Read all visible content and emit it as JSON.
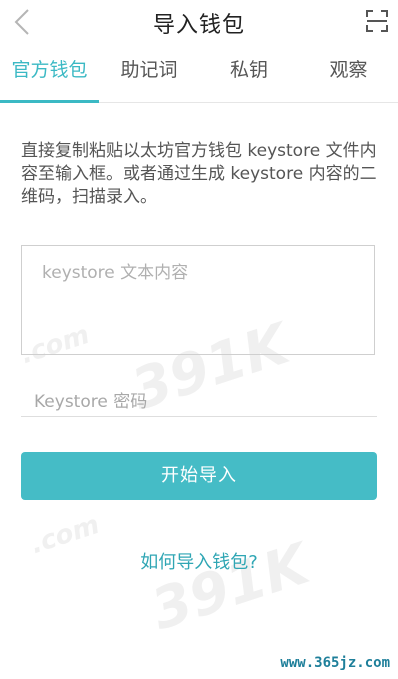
{
  "header": {
    "title": "导入钱包"
  },
  "tabs": [
    {
      "label": "官方钱包",
      "active": true
    },
    {
      "label": "助记词",
      "active": false
    },
    {
      "label": "私钥",
      "active": false
    },
    {
      "label": "观察",
      "active": false
    }
  ],
  "description": "直接复制粘贴以太坊官方钱包 keystore 文件内容至输入框。或者通过生成 keystore 内容的二维码，扫描录入。",
  "keystore_input": {
    "placeholder": "keystore 文本内容",
    "value": ""
  },
  "password_input": {
    "placeholder": "Keystore 密码",
    "value": ""
  },
  "import_button": {
    "label": "开始导入"
  },
  "help_link": {
    "label": "如何导入钱包?"
  },
  "watermarks": {
    "brand": "391K",
    "domain_text": ".com",
    "site": "www.365jz.com"
  },
  "icons": {
    "back": "back-chevron-icon",
    "scan": "scan-icon"
  },
  "colors": {
    "accent": "#3bb9c4",
    "button": "#45bcc6",
    "link": "#2fa6b4"
  }
}
